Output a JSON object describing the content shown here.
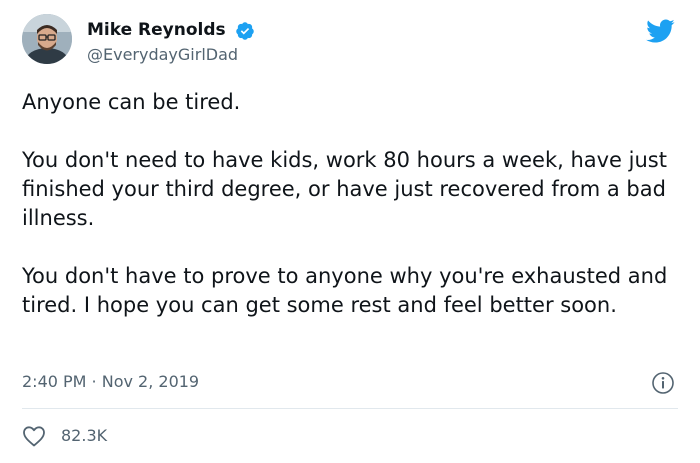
{
  "tweet": {
    "author": {
      "display_name": "Mike Reynolds",
      "handle": "@EverydayGirlDad",
      "verified": true
    },
    "text": "Anyone can be tired.\n\nYou don't need to have kids, work 80 hours a week, have just finished your third degree, or have just recovered from a bad illness.\n\nYou don't have to prove to anyone why you're exhausted and tired. I hope you can get some rest and feel better soon.",
    "timestamp": "2:40 PM · Nov 2, 2019",
    "likes": "82.3K"
  },
  "icons": {
    "verified": "verified-badge-icon",
    "platform": "twitter-bird-icon",
    "info": "info-icon",
    "like": "heart-icon"
  },
  "colors": {
    "brand": "#1da1f2",
    "text": "#0f1419",
    "secondary": "#536471",
    "divider": "#e1e8ed"
  }
}
